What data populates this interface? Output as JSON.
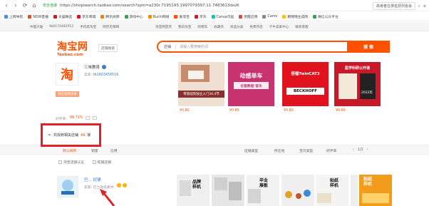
{
  "browser": {
    "secure_label": "安全连接",
    "url": "https://shopsearch.taobao.com/search?spm=a230r.7195193.1997079397.11.7483613dsvK",
    "search_hint": "高考者在排名前列省会",
    "bookmarks": [
      "上网导航",
      "NOW直播",
      "天猫精选",
      "京东商城",
      "腾讯视频",
      "游戏中心",
      "Ruchi网络",
      "爱淘宝",
      "京东",
      "Canva可画",
      "觉醒应用",
      "Camo",
      "粮锦锦生成网",
      "微信公众平台"
    ]
  },
  "taobao_top": {
    "left": [
      "中国大陆",
      "tb8174481P12",
      "手机逛淘宝",
      "网页无障碍"
    ],
    "right": [
      "淘宝网首页",
      "我的淘宝",
      "购物车",
      "收藏夹",
      "商品分类",
      "免费开店",
      "千牛卖家中心",
      "联系客服"
    ]
  },
  "logo": {
    "cn": "淘宝网",
    "en": "Taobao.com"
  },
  "shop_tag": "店铺搜索",
  "search": {
    "category": "店铺",
    "placeholder": "请输入要搜索的词",
    "button": "搜 索"
  },
  "shop1": {
    "avatar_glyph": "淘",
    "name": "三味教育",
    "seller_prefix": "卖家:",
    "seller": "tb1603458516",
    "label": "淘宝金牌卖家",
    "rating_prefix": "好评率:",
    "rating": "98.71%",
    "products": [
      {
        "price": "¥0.80",
        "caption": "零基础到独立入门34.4节"
      },
      {
        "price": "¥0.80",
        "caption": "全套教程·音乐",
        "headline": "动感单车"
      },
      {
        "price": "¥0.80",
        "caption": "BECKHOFF",
        "headline": "倍福TwinCAT3"
      },
      {
        "price": "¥0.60",
        "caption": "2022年",
        "headline": "医学科研公开课"
      }
    ]
  },
  "highlight": {
    "prefix": "共找到相关店铺",
    "count": "48",
    "suffix": "家"
  },
  "tabs": {
    "items": [
      "默认排序",
      "销量",
      "信用"
    ],
    "sort": [
      "店铺类型",
      "所在地",
      "宝贝类型",
      "好评率"
    ],
    "pager": "1/2"
  },
  "filters": [
    "淘宝店铺认证",
    "旺铺店铺"
  ],
  "shop2": {
    "name": "巴... 好铺",
    "seller": "卖家: 巴兰贴纸素材",
    "thumbs": [
      {
        "text": "品牌\n样机"
      },
      {
        "text": ""
      },
      {
        "text": "毕业\n展板"
      },
      {
        "text": ""
      },
      {
        "text": "贴纸\n样机"
      },
      {
        "text": ""
      },
      {
        "text": "贴纸\n样机"
      }
    ]
  }
}
